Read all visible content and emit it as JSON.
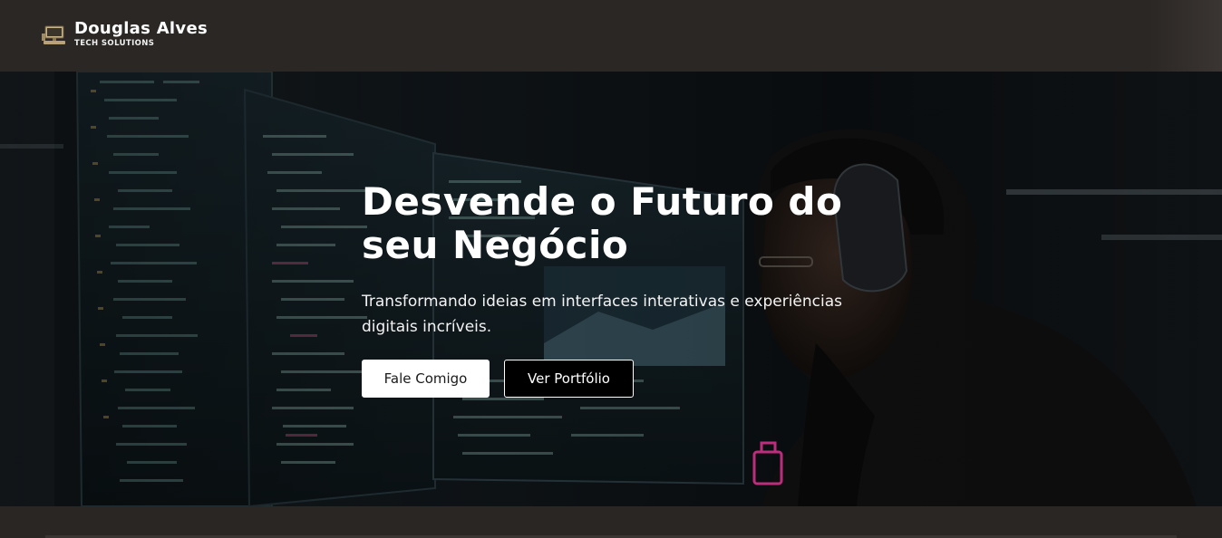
{
  "brand": {
    "name": "Douglas Alves",
    "tagline": "TECH SOLUTIONS",
    "icon": "desktop-computer-icon"
  },
  "hero": {
    "title_line1": "Desvende o Futuro do",
    "title_line2": "seu Negócio",
    "subtitle": "Transformando ideias em interfaces interativas e experiências digitais incríveis.",
    "background_image": "developer-at-monitors-photo",
    "buttons": {
      "contact_label": "Fale Comigo",
      "portfolio_label": "Ver Portfólio"
    }
  },
  "colors": {
    "navbar_bg": "#2b2725",
    "hero_bg": "#0d1114",
    "button_light": "#ffffff",
    "button_dark": "#000000",
    "accent_pink": "#ff3da8"
  }
}
